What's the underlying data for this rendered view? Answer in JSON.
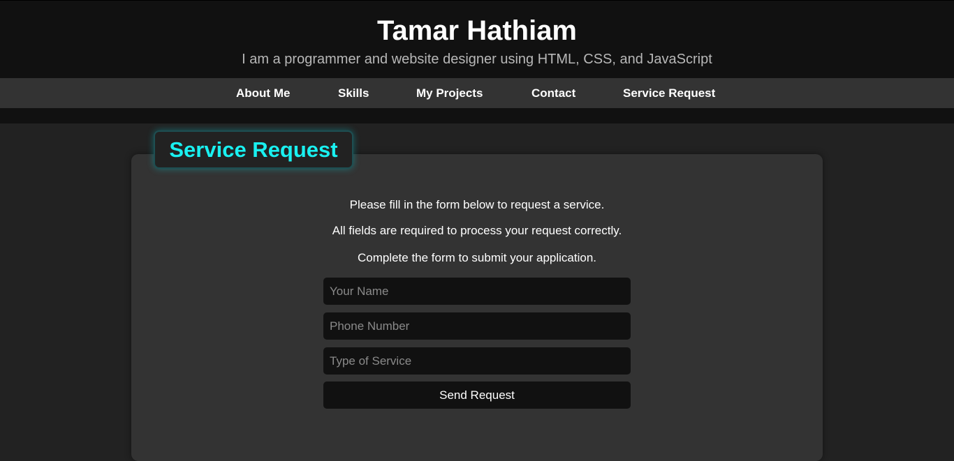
{
  "header": {
    "title": "Tamar Hathiam",
    "subtitle": "I am a programmer and website designer using HTML, CSS, and JavaScript"
  },
  "nav": {
    "items": [
      {
        "label": "About Me"
      },
      {
        "label": "Skills"
      },
      {
        "label": "My Projects"
      },
      {
        "label": "Contact"
      },
      {
        "label": "Service Request"
      }
    ]
  },
  "section": {
    "heading": "Service Request",
    "intro": [
      "Please fill in the form below to request a service.",
      "All fields are required to process your request correctly.",
      "Complete the form to submit your application."
    ]
  },
  "form": {
    "name_placeholder": "Your Name",
    "phone_placeholder": "Phone Number",
    "service_placeholder": "Type of Service",
    "submit_label": "Send Request"
  },
  "colors": {
    "accent": "#19f0f0",
    "page_background": "#222222",
    "header_background": "#111111",
    "nav_background": "#333333",
    "card_background": "#333333"
  }
}
